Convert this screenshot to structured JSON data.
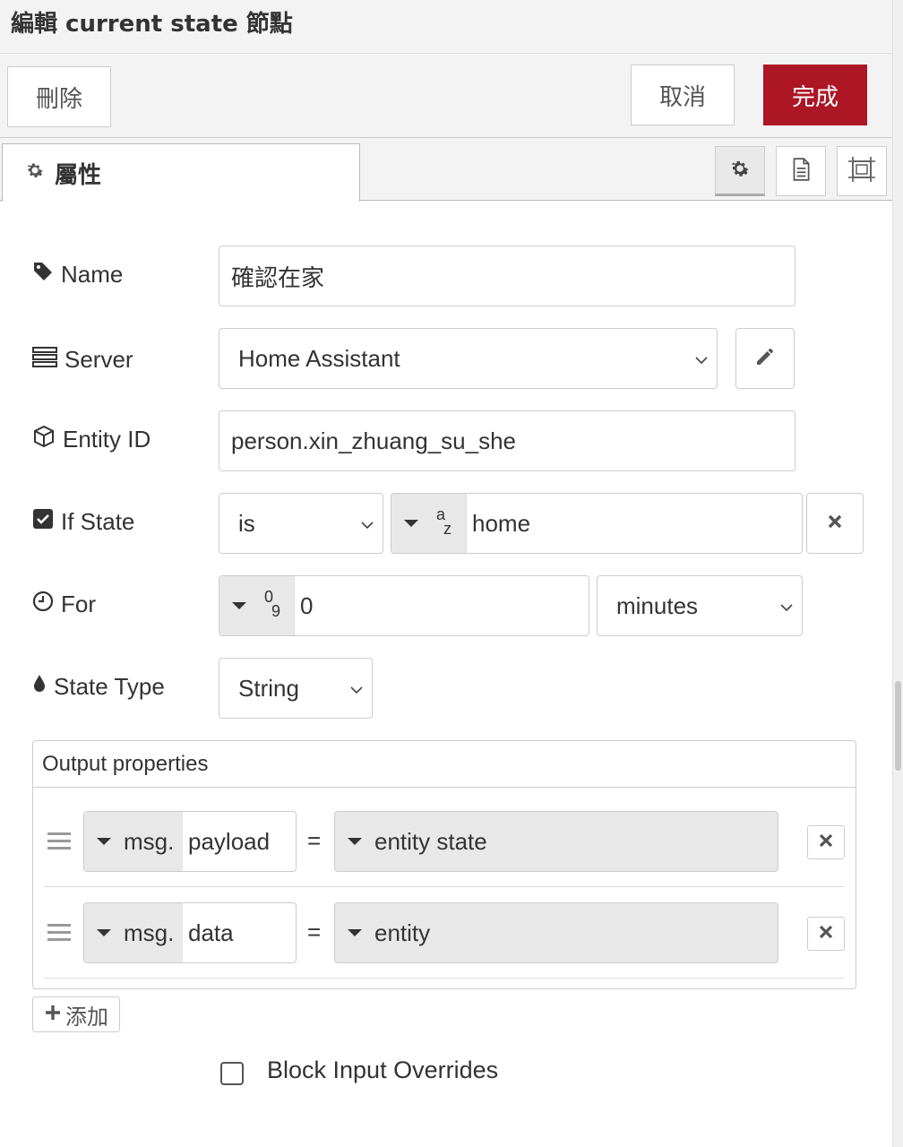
{
  "dialog": {
    "title": "編輯 current state 節點"
  },
  "buttons": {
    "delete": "刪除",
    "cancel": "取消",
    "done": "完成",
    "done_color": "#ad1625"
  },
  "tabs": {
    "properties": "屬性",
    "tools": [
      "gear-icon",
      "document-icon",
      "frame-icon"
    ]
  },
  "form": {
    "name": {
      "label": "Name",
      "value": "確認在家"
    },
    "server": {
      "label": "Server",
      "value": "Home Assistant"
    },
    "entity_id": {
      "label": "Entity ID",
      "value": "person.xin_zhuang_su_she"
    },
    "if_state": {
      "label": "If State",
      "operator": "is",
      "type_glyph_top": "a",
      "type_glyph_bottom": "z",
      "value": "home"
    },
    "for": {
      "label": "For",
      "type_glyph_top": "0",
      "type_glyph_bottom": "9",
      "value": "0",
      "unit": "minutes"
    },
    "state_type": {
      "label": "State Type",
      "value": "String"
    }
  },
  "output_properties": {
    "header": "Output properties",
    "rows": [
      {
        "prefix": "msg.",
        "property": "payload",
        "equals": "=",
        "value": "entity state"
      },
      {
        "prefix": "msg.",
        "property": "data",
        "equals": "=",
        "value": "entity"
      }
    ],
    "add_label": "添加"
  },
  "block_input_overrides": {
    "label": "Block Input Overrides",
    "checked": false
  }
}
